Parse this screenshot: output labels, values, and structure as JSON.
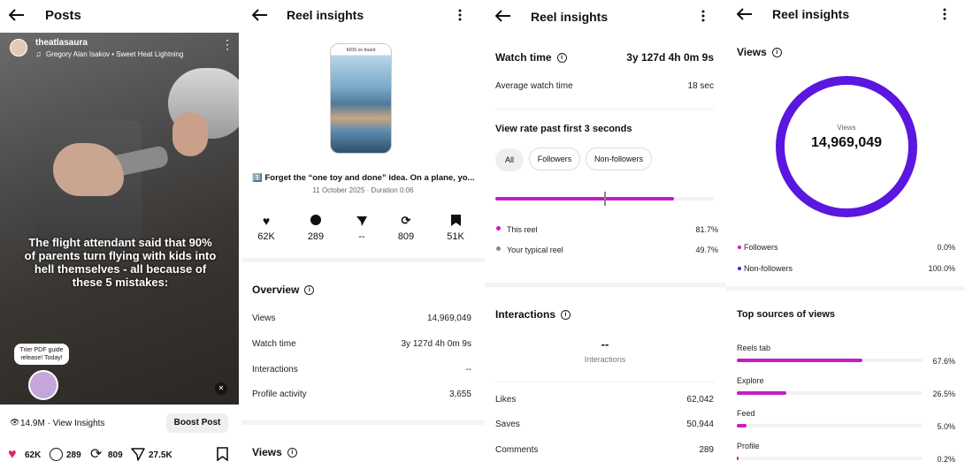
{
  "panel1": {
    "header_title": "Posts",
    "username": "theatlasaura",
    "music": "Gregory Alan Isakov • Sweet Heat Lightning",
    "overlay_text": "The flight attendant said that 90% of parents turn flying with kids into hell themselves - all because of these 5 mistakes:",
    "bubble_text": "Trier PDF guide release! Today!",
    "views_insights": "14.9M · View Insights",
    "boost_label": "Boost Post",
    "likes": "62K",
    "comments": "289",
    "reposts": "809",
    "shares": "27.5K"
  },
  "panel2": {
    "header_title": "Reel insights",
    "reel_thumb_text": "KIDS on board",
    "caption": "1️⃣ Forget the “one toy and done” idea. On a plane, yo...",
    "meta": "11 October 2025 · Duration 0:06",
    "stats": [
      {
        "icon": "heart-icon",
        "value": "62K"
      },
      {
        "icon": "comment-icon",
        "value": "289"
      },
      {
        "icon": "send-icon",
        "value": "--"
      },
      {
        "icon": "repost-icon",
        "value": "809"
      },
      {
        "icon": "save-icon",
        "value": "51K"
      }
    ],
    "overview_title": "Overview",
    "overview_rows": [
      {
        "label": "Views",
        "value": "14,969,049"
      },
      {
        "label": "Watch time",
        "value": "3y 127d 4h 0m 9s"
      },
      {
        "label": "Interactions",
        "value": "--"
      },
      {
        "label": "Profile activity",
        "value": "3,655"
      }
    ],
    "views_title": "Views"
  },
  "panel3": {
    "header_title": "Reel insights",
    "watch_time_title": "Watch time",
    "watch_time_value": "3y 127d 4h 0m 9s",
    "avg_label": "Average watch time",
    "avg_value": "18 sec",
    "view_rate_title": "View rate past first 3 seconds",
    "filters": [
      "All",
      "Followers",
      "Non-followers"
    ],
    "this_reel_label": "This reel",
    "this_reel_value": "81.7%",
    "this_reel_fraction": 0.817,
    "typical_label": "Your typical reel",
    "typical_value": "49.7%",
    "typical_fraction": 0.497,
    "interactions_title": "Interactions",
    "interactions_value": "--",
    "interactions_sub": "Interactions",
    "rows": [
      {
        "label": "Likes",
        "value": "62,042"
      },
      {
        "label": "Saves",
        "value": "50,944"
      },
      {
        "label": "Comments",
        "value": "289"
      }
    ]
  },
  "panel4": {
    "header_title": "Reel insights",
    "views_title": "Views",
    "ring_label": "Views",
    "ring_value": "14,969,049",
    "followers_label": "Followers",
    "followers_value": "0.0%",
    "nonfollowers_label": "Non-followers",
    "nonfollowers_value": "100.0%",
    "sources_title": "Top sources of views",
    "sources": [
      {
        "label": "Reels tab",
        "value": "67.6%",
        "fraction": 0.676
      },
      {
        "label": "Explore",
        "value": "26.5%",
        "fraction": 0.265
      },
      {
        "label": "Feed",
        "value": "5.0%",
        "fraction": 0.05
      },
      {
        "label": "Profile",
        "value": "0.2%",
        "fraction": 0.002
      }
    ]
  },
  "colors": {
    "accent": "#c61cc6",
    "ring": "#5b16e0",
    "heart": "#e0245e"
  }
}
